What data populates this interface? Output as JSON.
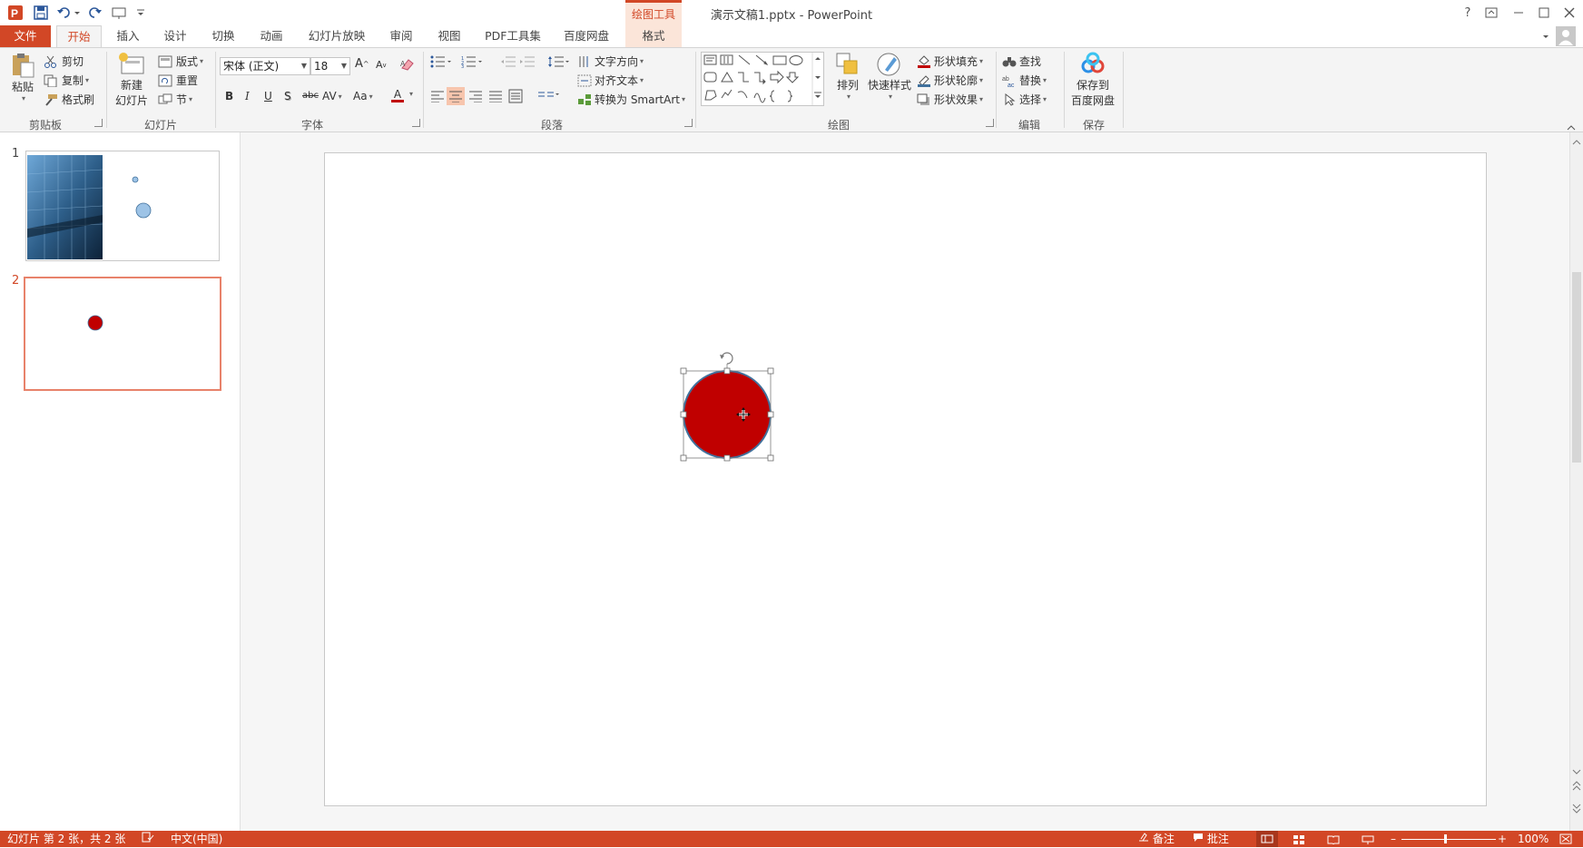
{
  "app": {
    "title": "演示文稿1.pptx - PowerPoint"
  },
  "context_tab": {
    "header": "绘图工具"
  },
  "tabs": [
    "文件",
    "开始",
    "插入",
    "设计",
    "切换",
    "动画",
    "幻灯片放映",
    "审阅",
    "视图",
    "PDF工具集",
    "百度网盘",
    "格式"
  ],
  "ribbon": {
    "clipboard": {
      "paste": "粘贴",
      "cut": "剪切",
      "copy": "复制",
      "format_painter": "格式刷",
      "label": "剪贴板"
    },
    "slides": {
      "new_slide_1": "新建",
      "new_slide_2": "幻灯片",
      "layout": "版式",
      "reset": "重置",
      "section": "节",
      "label": "幻灯片"
    },
    "font": {
      "name": "宋体 (正文)",
      "size": "18",
      "bold": "B",
      "italic": "I",
      "underline": "U",
      "shadow": "S",
      "strike": "abc",
      "spacing": "AV",
      "case": "Aa",
      "color": "A",
      "grow": "A",
      "shrink": "A",
      "label": "字体"
    },
    "paragraph": {
      "text_direction": "文字方向",
      "align_text": "对齐文本",
      "smartart": "转换为 SmartArt",
      "label": "段落"
    },
    "drawing": {
      "arrange": "排列",
      "quick_styles": "快速样式",
      "shape_fill": "形状填充",
      "shape_outline": "形状轮廓",
      "shape_effects": "形状效果",
      "label": "绘图"
    },
    "editing": {
      "find": "查找",
      "replace": "替换",
      "select": "选择",
      "label": "编辑"
    },
    "save": {
      "save_to_1": "保存到",
      "save_to_2": "百度网盘",
      "label": "保存"
    }
  },
  "thumbnails": [
    {
      "number": "1"
    },
    {
      "number": "2"
    }
  ],
  "status": {
    "slide_info": "幻灯片 第 2 张，共 2 张",
    "language": "中文(中国)",
    "notes": "备注",
    "comments": "批注",
    "zoom": "100%"
  },
  "colors": {
    "accent": "#d24726",
    "shape_fill": "#c00000",
    "shape_outline": "#41719c",
    "thumb_circle": "#9dc3e6"
  }
}
